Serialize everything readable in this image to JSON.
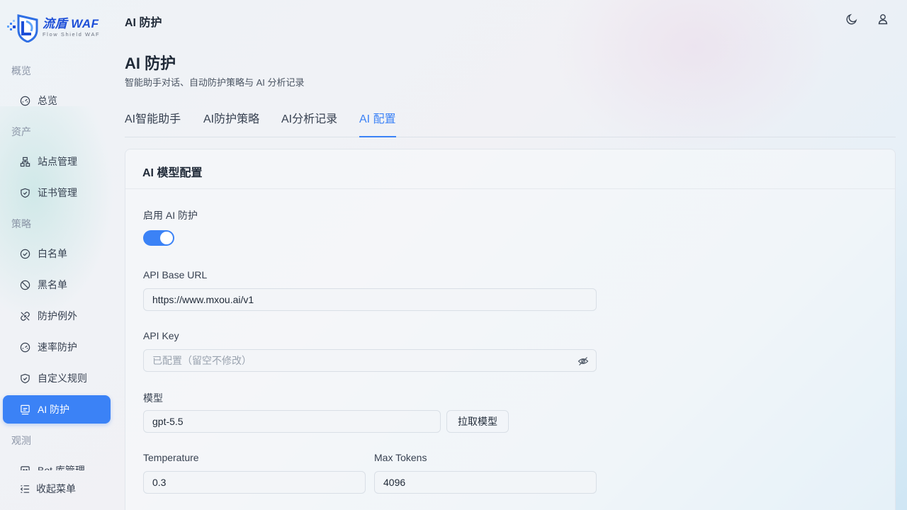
{
  "app": {
    "logo_title": "流盾 WAF",
    "logo_sub": "Flow Shield WAF"
  },
  "sidebar": {
    "groups": [
      {
        "label": "概览"
      },
      {
        "label": "资产"
      },
      {
        "label": "策略"
      },
      {
        "label": "观测"
      }
    ],
    "items": [
      {
        "label": "总览",
        "icon": "dashboard-icon"
      },
      {
        "label": "站点管理",
        "icon": "sitemap-icon"
      },
      {
        "label": "证书管理",
        "icon": "shield-check-icon"
      },
      {
        "label": "白名单",
        "icon": "check-circle-icon"
      },
      {
        "label": "黑名单",
        "icon": "ban-icon"
      },
      {
        "label": "防护例外",
        "icon": "link-off-icon"
      },
      {
        "label": "速率防护",
        "icon": "speedometer-icon"
      },
      {
        "label": "自定义规则",
        "icon": "shield-check-icon"
      },
      {
        "label": "AI 防护",
        "icon": "ai-icon",
        "active": true
      },
      {
        "label": "Bot 库管理",
        "icon": "bot-icon"
      }
    ],
    "collapse_label": "收起菜单"
  },
  "header": {
    "title": "AI 防护",
    "icons": [
      "moon-icon",
      "user-icon"
    ]
  },
  "page": {
    "title": "AI 防护",
    "subtitle": "智能助手对话、自动防护策略与 AI 分析记录"
  },
  "tabs": [
    {
      "label": "AI智能助手"
    },
    {
      "label": "AI防护策略"
    },
    {
      "label": "AI分析记录"
    },
    {
      "label": "AI 配置",
      "active": true
    }
  ],
  "card": {
    "title": "AI 模型配置",
    "enable_label": "启用 AI 防护",
    "enabled": true,
    "base_url_label": "API Base URL",
    "base_url_value": "https://www.mxou.ai/v1",
    "api_key_label": "API Key",
    "api_key_placeholder": "已配置（留空不修改）",
    "model_label": "模型",
    "model_value": "gpt-5.5",
    "fetch_models_label": "拉取模型",
    "temperature_label": "Temperature",
    "temperature_value": "0.3",
    "max_tokens_label": "Max Tokens",
    "max_tokens_value": "4096"
  },
  "colors": {
    "accent": "#3b82f6",
    "text": "#1f2937",
    "muted": "#8a94a6"
  }
}
